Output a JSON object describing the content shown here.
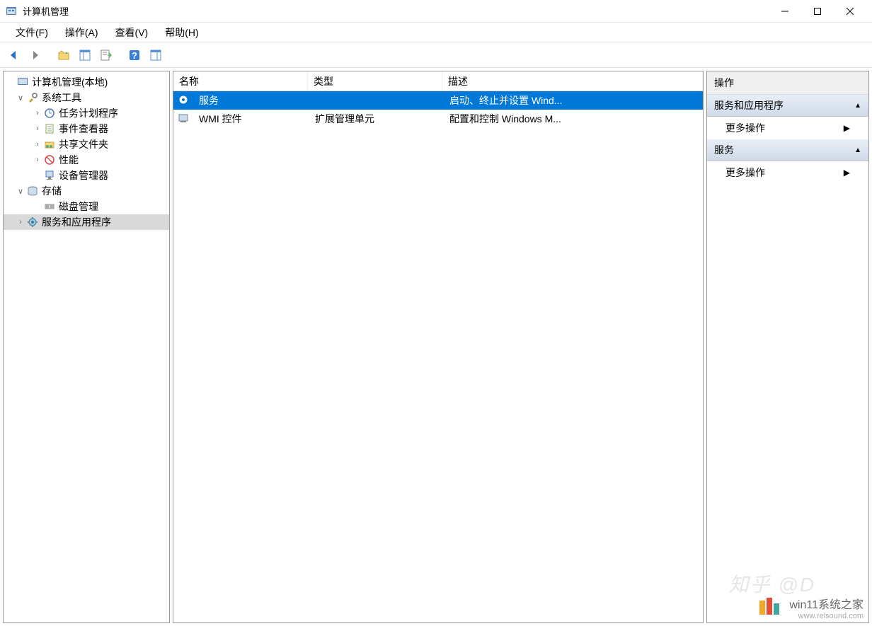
{
  "window": {
    "title": "计算机管理"
  },
  "menubar": {
    "items": [
      "文件(F)",
      "操作(A)",
      "查看(V)",
      "帮助(H)"
    ]
  },
  "tree": {
    "root": "计算机管理(本地)",
    "nodes": [
      {
        "label": "系统工具",
        "indent": 1,
        "expander": "∨",
        "icon": "tools"
      },
      {
        "label": "任务计划程序",
        "indent": 2,
        "expander": "›",
        "icon": "clock"
      },
      {
        "label": "事件查看器",
        "indent": 2,
        "expander": "›",
        "icon": "event"
      },
      {
        "label": "共享文件夹",
        "indent": 2,
        "expander": "›",
        "icon": "share"
      },
      {
        "label": "性能",
        "indent": 2,
        "expander": "›",
        "icon": "perf"
      },
      {
        "label": "设备管理器",
        "indent": 2,
        "expander": "",
        "icon": "device"
      },
      {
        "label": "存储",
        "indent": 1,
        "expander": "∨",
        "icon": "storage"
      },
      {
        "label": "磁盘管理",
        "indent": 2,
        "expander": "",
        "icon": "disk"
      },
      {
        "label": "服务和应用程序",
        "indent": 1,
        "expander": "›",
        "icon": "services",
        "selected": true
      }
    ]
  },
  "list": {
    "headers": {
      "name": "名称",
      "type": "类型",
      "desc": "描述"
    },
    "rows": [
      {
        "name": "服务",
        "type": "",
        "desc": "启动、终止并设置 Wind...",
        "selected": true,
        "icon": "gear"
      },
      {
        "name": "WMI 控件",
        "type": "扩展管理单元",
        "desc": "配置和控制 Windows M...",
        "selected": false,
        "icon": "wmi"
      }
    ]
  },
  "actions": {
    "header": "操作",
    "sections": [
      {
        "title": "服务和应用程序",
        "items": [
          "更多操作"
        ]
      },
      {
        "title": "服务",
        "items": [
          "更多操作"
        ]
      }
    ]
  },
  "watermark": {
    "zhihu": "知乎 @D",
    "brand_title": "win11系统之家",
    "brand_url": "www.relsound.com"
  }
}
